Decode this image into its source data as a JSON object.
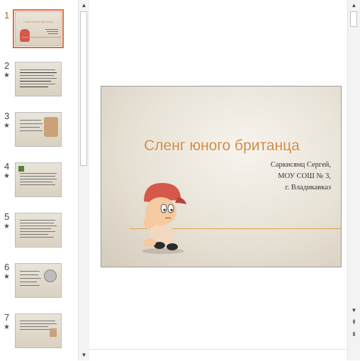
{
  "thumbnails": [
    {
      "number": "1",
      "star": ""
    },
    {
      "number": "2",
      "star": "★"
    },
    {
      "number": "3",
      "star": "★"
    },
    {
      "number": "4",
      "star": "★"
    },
    {
      "number": "5",
      "star": "★"
    },
    {
      "number": "6",
      "star": "★"
    },
    {
      "number": "7",
      "star": "★"
    }
  ],
  "slide": {
    "title": "Сленг юного британца",
    "subtitle_line1": "Саркисянц Сергей,",
    "subtitle_line2": "МОУ СОШ № 3,",
    "subtitle_line3": "г. Владикавказ"
  },
  "thumb1_title": "Сленг юного британца",
  "scroll_icons": {
    "up": "arrow-up-icon",
    "down": "arrow-down-icon",
    "prev_slide": "prev-slide-icon",
    "next_slide": "next-slide-icon"
  },
  "colors": {
    "accent": "#e26d3e",
    "title": "#d08b43"
  }
}
